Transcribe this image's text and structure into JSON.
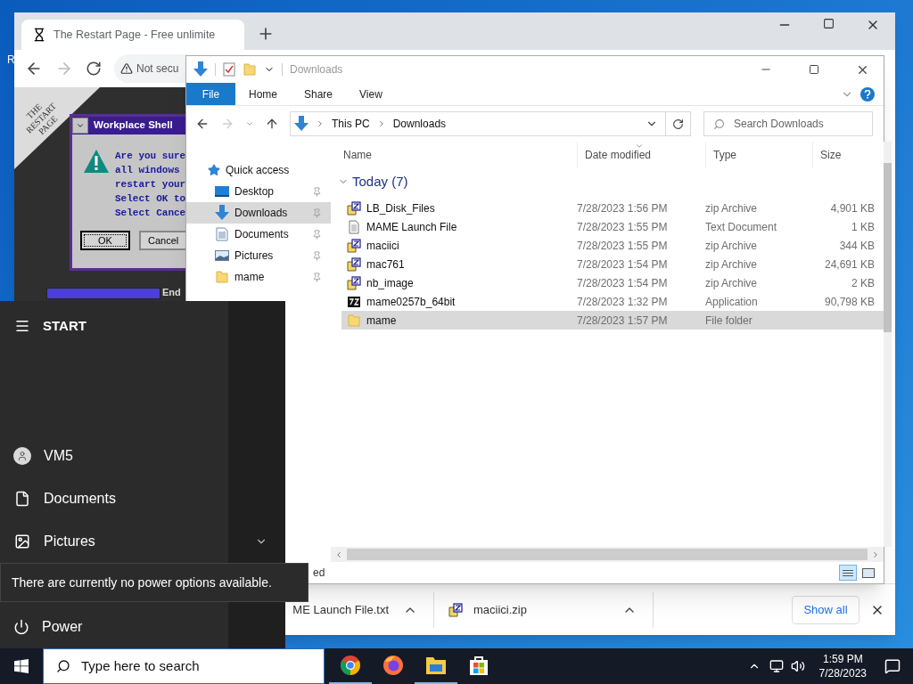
{
  "desktop": {
    "icon_label": "R"
  },
  "browser": {
    "tab": {
      "title": "The Restart Page - Free unlimite"
    },
    "address": {
      "security": "Not secu"
    },
    "page": {
      "banner": "THE RESTART PAGE",
      "dialog": {
        "title": "Workplace Shell",
        "lines": [
          "Are you sure",
          "all windows",
          "restart your",
          "Select OK to",
          "Select Cance"
        ],
        "buttons": [
          {
            "label": "OK",
            "selected": true
          },
          {
            "label": "Cancel",
            "selected": false
          }
        ]
      },
      "bar_label": "End"
    },
    "downloads": [
      {
        "name": "ME Launch File.txt"
      },
      {
        "name": "maciici.zip",
        "kind": "zip"
      }
    ],
    "show_all": "Show all"
  },
  "explorer": {
    "title": "Downloads",
    "ribbon_tabs": [
      {
        "label": "File",
        "kind": "menu"
      },
      {
        "label": "Home",
        "kind": "tab"
      },
      {
        "label": "Share",
        "kind": "tab"
      },
      {
        "label": "View",
        "kind": "tab"
      }
    ],
    "breadcrumb": [
      "This PC",
      "Downloads"
    ],
    "search": {
      "placeholder": "Search Downloads"
    },
    "nav": {
      "header": "Quick access",
      "items": [
        {
          "label": "Desktop",
          "kind": "desktop",
          "selected": false
        },
        {
          "label": "Downloads",
          "kind": "downloads",
          "selected": true
        },
        {
          "label": "Documents",
          "kind": "documents",
          "selected": false
        },
        {
          "label": "Pictures",
          "kind": "pictures",
          "selected": false
        },
        {
          "label": "mame",
          "kind": "folder",
          "selected": false
        }
      ]
    },
    "columns": [
      {
        "label": "Name",
        "sorted": false
      },
      {
        "label": "Date modified",
        "sorted": true
      },
      {
        "label": "Type",
        "sorted": false
      },
      {
        "label": "Size",
        "sorted": false
      }
    ],
    "group": {
      "label": "Today (7)",
      "expanded": true
    },
    "rows": [
      {
        "name": "LB_Disk_Files",
        "kind": "zip",
        "date": "7/28/2023 1:56 PM",
        "type": "zip Archive",
        "size": "4,901 KB",
        "selected": false
      },
      {
        "name": "MAME Launch File",
        "kind": "text",
        "date": "7/28/2023 1:55 PM",
        "type": "Text Document",
        "size": "1 KB",
        "selected": false
      },
      {
        "name": "maciici",
        "kind": "zip",
        "date": "7/28/2023 1:55 PM",
        "type": "zip Archive",
        "size": "344 KB",
        "selected": false
      },
      {
        "name": "mac761",
        "kind": "zip",
        "date": "7/28/2023 1:54 PM",
        "type": "zip Archive",
        "size": "24,691 KB",
        "selected": false
      },
      {
        "name": "nb_image",
        "kind": "zip",
        "date": "7/28/2023 1:54 PM",
        "type": "zip Archive",
        "size": "2 KB",
        "selected": false
      },
      {
        "name": "mame0257b_64bit",
        "kind": "app",
        "date": "7/28/2023 1:32 PM",
        "type": "Application",
        "size": "90,798 KB",
        "selected": false
      },
      {
        "name": "mame",
        "kind": "folder",
        "date": "7/28/2023 1:57 PM",
        "type": "File folder",
        "selected": true
      }
    ],
    "status": "ed"
  },
  "start_menu": {
    "title": "START",
    "items": [
      {
        "label": "VM5",
        "kind": "user",
        "expandable": false
      },
      {
        "label": "Documents",
        "kind": "documents",
        "expandable": false
      },
      {
        "label": "Pictures",
        "kind": "pictures",
        "expandable": true
      }
    ],
    "power": "Power",
    "tooltip": "There are currently no power options available."
  },
  "taskbar": {
    "search_placeholder": "Type here to search",
    "apps": [
      {
        "kind": "chrome",
        "running": true
      },
      {
        "kind": "firefox",
        "running": false
      },
      {
        "kind": "explorer",
        "running": true
      },
      {
        "kind": "store",
        "running": false
      }
    ],
    "time": "1:59 PM",
    "date": "7/28/2023"
  }
}
